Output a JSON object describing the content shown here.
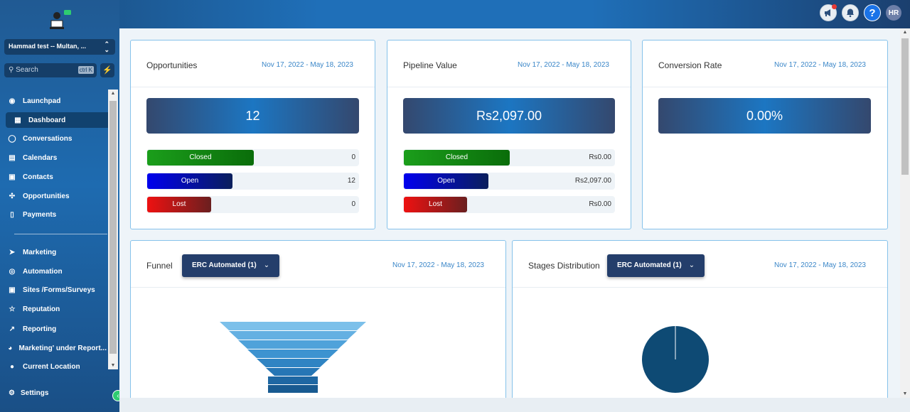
{
  "header": {
    "avatar": "HR",
    "help": "?"
  },
  "sidebar": {
    "location": "Hammad test -- Multan, ...",
    "search_placeholder": "Search",
    "search_shortcut": "ctrl K",
    "items": [
      {
        "label": "Launchpad",
        "icon": "rocket-icon"
      },
      {
        "label": "Dashboard",
        "icon": "grid-icon",
        "active": true
      },
      {
        "label": "Conversations",
        "icon": "chat-icon"
      },
      {
        "label": "Calendars",
        "icon": "calendar-icon"
      },
      {
        "label": "Contacts",
        "icon": "contacts-icon"
      },
      {
        "label": "Opportunities",
        "icon": "network-icon"
      },
      {
        "label": "Payments",
        "icon": "receipt-icon"
      },
      {
        "label": "Marketing",
        "icon": "send-icon"
      },
      {
        "label": "Automation",
        "icon": "automation-icon"
      },
      {
        "label": "Sites /Forms/Surveys",
        "icon": "form-icon"
      },
      {
        "label": "Reputation",
        "icon": "star-icon"
      },
      {
        "label": "Reporting",
        "icon": "trend-icon"
      },
      {
        "label": "Marketing' under Report...",
        "icon": "pie-icon"
      },
      {
        "label": "Current Location",
        "icon": "person-icon"
      }
    ],
    "settings": "Settings"
  },
  "cards": {
    "opportunities": {
      "title": "Opportunities",
      "date": "Nov 17, 2022 - May 18, 2023",
      "value": "12",
      "rows": [
        {
          "label": "Closed",
          "value": "0",
          "fill": 0.5
        },
        {
          "label": "Open",
          "value": "12",
          "fill": 0.4
        },
        {
          "label": "Lost",
          "value": "0",
          "fill": 0.3
        }
      ]
    },
    "pipeline": {
      "title": "Pipeline Value",
      "date": "Nov 17, 2022 - May 18, 2023",
      "value": "Rs2,097.00",
      "rows": [
        {
          "label": "Closed",
          "value": "Rs0.00",
          "fill": 0.5
        },
        {
          "label": "Open",
          "value": "Rs2,097.00",
          "fill": 0.4
        },
        {
          "label": "Lost",
          "value": "Rs0.00",
          "fill": 0.3
        }
      ]
    },
    "conversion": {
      "title": "Conversion Rate",
      "date": "Nov 17, 2022 - May 18, 2023",
      "value": "0.00%"
    },
    "funnel": {
      "title": "Funnel",
      "dropdown": "ERC Automated (1)",
      "date": "Nov 17, 2022 - May 18, 2023"
    },
    "stages": {
      "title": "Stages Distribution",
      "dropdown": "ERC Automated (1)",
      "date": "Nov 17, 2022 - May 18, 2023"
    }
  },
  "colors": {
    "accent": "#1f6fb8",
    "closed": "#0a8a0a",
    "open": "#0000ee",
    "lost": "#ee1111",
    "pie": "#0e4a74"
  }
}
